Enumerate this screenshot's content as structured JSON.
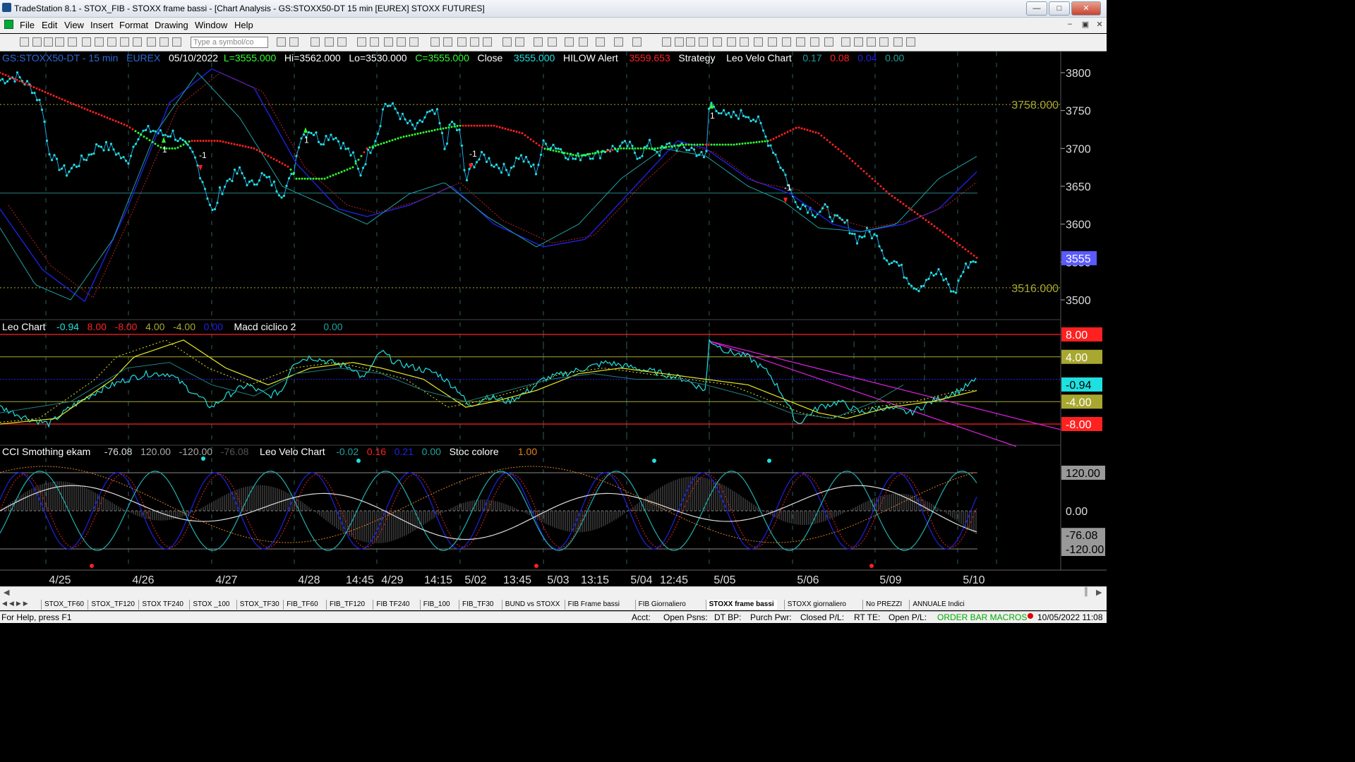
{
  "window": {
    "title": "TradeStation 8.1 - STOX_FIB - STOXX frame bassi - [Chart Analysis - GS:STOXX50-DT  15 min  [EUREX] STOXX FUTURES]"
  },
  "menu": [
    "File",
    "Edit",
    "View",
    "Insert",
    "Format",
    "Drawing",
    "Window",
    "Help"
  ],
  "toolbar": {
    "symbol_placeholder": "Type a symbol/co"
  },
  "header": {
    "symbol": "GS:STOXX50-DT - 15 min",
    "exchange": "EUREX",
    "date": "05/10/2022",
    "last": "L=3555.000",
    "hi": "Hi=3562.000",
    "lo": "Lo=3530.000",
    "close_c": "C=3555.000",
    "close_label": "Close",
    "close_val": "3555.000",
    "hilow": "HILOW Alert",
    "hilow_val": "3559.653",
    "strategy": "Strategy",
    "velo": "Leo Velo Chart",
    "v1": "0.17",
    "v2": "0.08",
    "v3": "0.04",
    "v4": "0.00"
  },
  "panel2_header": {
    "name": "Leo Chart",
    "a": "-0.94",
    "b": "8.00",
    "c": "-8.00",
    "d": "4.00",
    "e": "-4.00",
    "f": "0.00",
    "macd": "Macd ciclico 2",
    "macd_val": "0.00"
  },
  "panel3_header": {
    "name": "CCI Smothing ekam",
    "a": "-76.08",
    "b": "120.00",
    "c": "-120.00",
    "d": "-76.08",
    "velo": "Leo Velo Chart",
    "v1": "-0.02",
    "v2": "0.16",
    "v3": "0.21",
    "v4": "0.00",
    "stoc": "Stoc colore",
    "stoc_val": "1.00"
  },
  "price_axis": {
    "ticks": [
      "3800",
      "3750",
      "3700",
      "3650",
      "3600",
      "3550",
      "3500"
    ],
    "level_high": "3758.000",
    "level_low": "3516.000",
    "last_tag": "3555"
  },
  "panel2_axis": {
    "tags": [
      "8.00",
      "4.00",
      "-0.94",
      "-4.00",
      "-8.00"
    ]
  },
  "panel3_axis": {
    "tags": [
      "120.00",
      "0.00",
      "-76.08",
      "-120.00"
    ]
  },
  "time_axis": [
    "4/25",
    "4/26",
    "4/27",
    "4/28",
    "14:45",
    "4/29",
    "14:15",
    "5/02",
    "13:45",
    "5/03",
    "13:15",
    "5/04",
    "12:45",
    "5/05",
    "5/06",
    "5/09",
    "5/10"
  ],
  "signals": {
    "long": "1",
    "short": "-1"
  },
  "tabs": [
    "STOX_TF60",
    "STOX_TF120",
    "STOX TF240",
    "STOX _100",
    "STOX_TF30",
    "FIB_TF60",
    "FIB_TF120",
    "FIB TF240",
    "FIB_100",
    "FIB_TF30",
    "BUND vs STOXX",
    "FIB Frame bassi",
    "FIB Giornaliero",
    "STOXX frame bassi",
    "STOXX giornaliero",
    "No PREZZI",
    "ANNUALE Indici"
  ],
  "active_tab": "STOXX frame bassi",
  "status": {
    "help": "For Help, press F1",
    "acct": "Acct:",
    "open_psns": "Open Psns:",
    "dt_bp": "DT BP:",
    "purch_pwr": "Purch Pwr:",
    "closed_pl": "Closed P/L:",
    "rt_te": "RT TE:",
    "open_pl": "Open P/L:",
    "macros": "ORDER BAR  MACROS",
    "datetime": "10/05/2022 11:08"
  },
  "colors": {
    "cyan": "#1fe0e0",
    "red": "#ff2020",
    "green": "#30ff30",
    "blue": "#2020e0",
    "yellow": "#e8e820",
    "olive": "#a8a830",
    "magenta": "#e020e0",
    "white": "#ffffff"
  }
}
